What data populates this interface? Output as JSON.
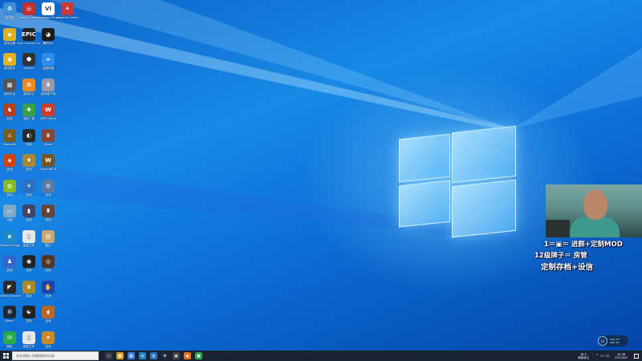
{
  "desktop_icons": [
    {
      "name": "icon-1-1",
      "label": "回收站",
      "color": "#3b8fd6",
      "glyph": "♻"
    },
    {
      "name": "icon-1-2",
      "label": "Steam Client",
      "color": "#c2302d",
      "glyph": "◎"
    },
    {
      "name": "icon-1-3",
      "label": "Wallpaper Engine",
      "color": "#ffffff",
      "glyph": "VI"
    },
    {
      "name": "icon-1-4",
      "label": "Legends Game",
      "color": "#c83a3a",
      "glyph": "✦"
    },
    {
      "name": "icon-2-1",
      "label": "游戏加速",
      "color": "#e0b020",
      "glyph": "◆"
    },
    {
      "name": "icon-2-2",
      "label": "Epic Games Launcher",
      "color": "#222222",
      "glyph": "EPIC"
    },
    {
      "name": "icon-2-3",
      "label": "腾讯QQ",
      "color": "#1b1b1b",
      "glyph": "◕"
    },
    {
      "name": "icon-3-1",
      "label": "游戏助手",
      "color": "#e0b020",
      "glyph": "◉"
    },
    {
      "name": "icon-3-2",
      "label": "Garena",
      "color": "#333333",
      "glyph": "⬢"
    },
    {
      "name": "icon-3-3",
      "label": "百度网盘",
      "color": "#2c8ff0",
      "glyph": "∞"
    },
    {
      "name": "icon-4-1",
      "label": "游戏平台",
      "color": "#555555",
      "glyph": "▦"
    },
    {
      "name": "icon-4-2",
      "label": "游戏中心",
      "color": "#f08a1c",
      "glyph": "✿"
    },
    {
      "name": "icon-4-3",
      "label": "游戏客户端",
      "color": "#9999aa",
      "glyph": "♜"
    },
    {
      "name": "icon-5-1",
      "label": "游戏",
      "color": "#b04020",
      "glyph": "♞"
    },
    {
      "name": "icon-5-2",
      "label": "游戏工具",
      "color": "#3aa044",
      "glyph": "✚"
    },
    {
      "name": "icon-5-3",
      "label": "WPS Office",
      "color": "#d23a2a",
      "glyph": "W"
    },
    {
      "name": "icon-6-1",
      "label": "Warcraft",
      "color": "#7a5a20",
      "glyph": "⚔"
    },
    {
      "name": "icon-6-2",
      "label": "游戏",
      "color": "#2a2a2a",
      "glyph": "◐"
    },
    {
      "name": "icon-6-3",
      "label": "Game",
      "color": "#884433",
      "glyph": "♛"
    },
    {
      "name": "icon-7-1",
      "label": "游戏",
      "color": "#cc4411",
      "glyph": "◈"
    },
    {
      "name": "icon-7-2",
      "label": "游戏",
      "color": "#aa8833",
      "glyph": "♦"
    },
    {
      "name": "icon-7-3",
      "label": "Warcraft III",
      "color": "#775522",
      "glyph": "W"
    },
    {
      "name": "icon-8-1",
      "label": "游戏",
      "color": "#88bb22",
      "glyph": "◍"
    },
    {
      "name": "icon-8-2",
      "label": "游戏",
      "color": "#2a6fc0",
      "glyph": "✈"
    },
    {
      "name": "icon-8-3",
      "label": "游戏",
      "color": "#5a7aa0",
      "glyph": "⚙"
    },
    {
      "name": "icon-9-1",
      "label": "电脑",
      "color": "#7fa8c8",
      "glyph": "▭"
    },
    {
      "name": "icon-9-2",
      "label": "游戏",
      "color": "#444466",
      "glyph": "▮"
    },
    {
      "name": "icon-9-3",
      "label": "游戏",
      "color": "#664433",
      "glyph": "♜"
    },
    {
      "name": "icon-10-1",
      "label": "Microsoft Edge",
      "color": "#1e88c8",
      "glyph": "e"
    },
    {
      "name": "icon-10-2",
      "label": "新建文本",
      "color": "#e8e8e8",
      "glyph": "▯"
    },
    {
      "name": "icon-10-3",
      "label": "图片",
      "color": "#c9a66b",
      "glyph": "▤"
    },
    {
      "name": "icon-11-1",
      "label": "游戏",
      "color": "#3366cc",
      "glyph": "♟"
    },
    {
      "name": "icon-11-2",
      "label": "游戏",
      "color": "#222222",
      "glyph": "◉"
    },
    {
      "name": "icon-11-3",
      "label": "游戏",
      "color": "#553322",
      "glyph": "◎"
    },
    {
      "name": "icon-12-1",
      "label": "GeForce Experience",
      "color": "#2a2a2a",
      "glyph": "◤"
    },
    {
      "name": "icon-12-2",
      "label": "游戏",
      "color": "#aa8822",
      "glyph": "♛"
    },
    {
      "name": "icon-12-3",
      "label": "游戏",
      "color": "#2244aa",
      "glyph": "✋"
    },
    {
      "name": "icon-13-1",
      "label": "Steam",
      "color": "#1b2838",
      "glyph": "⚙"
    },
    {
      "name": "icon-13-2",
      "label": "游戏",
      "color": "#222222",
      "glyph": "☯"
    },
    {
      "name": "icon-13-3",
      "label": "游戏",
      "color": "#bb6622",
      "glyph": "◖"
    },
    {
      "name": "icon-14-1",
      "label": "微信",
      "color": "#2aa84a",
      "glyph": "✉"
    },
    {
      "name": "icon-14-2",
      "label": "新建文本",
      "color": "#e8e8e8",
      "glyph": "▯"
    },
    {
      "name": "icon-14-3",
      "label": "游戏",
      "color": "#cc8822",
      "glyph": "✦"
    }
  ],
  "stream_overlay": {
    "line1": "1＝▣＝ 进群+定制MOD",
    "line2": "12级牌子＝ 房管",
    "line3": "定制存档+设信"
  },
  "taskbar": {
    "search_placeholder": "在这里输入你要搜索的内容",
    "pinned": [
      {
        "name": "task-view-icon",
        "glyph": "▭",
        "color": "#333a48"
      },
      {
        "name": "file-explorer-icon",
        "glyph": "▣",
        "color": "#d9a520"
      },
      {
        "name": "store-icon",
        "glyph": "▦",
        "color": "#3a7bd5"
      },
      {
        "name": "edge-icon",
        "glyph": "e",
        "color": "#1e88c8"
      },
      {
        "name": "app-icon-1",
        "glyph": "◍",
        "color": "#2a6fc0"
      },
      {
        "name": "steam-taskbar-icon",
        "glyph": "⚙",
        "color": "#1b2838"
      },
      {
        "name": "app-icon-2",
        "glyph": "◉",
        "color": "#444"
      },
      {
        "name": "app-icon-3",
        "glyph": "◆",
        "color": "#e07020"
      },
      {
        "name": "app-icon-4",
        "glyph": "◼",
        "color": "#2aa84a"
      }
    ],
    "tray_weather": "28°C",
    "tray_weather_sub": "局部多云",
    "tray_time": "20:38",
    "tray_date": "2021/8/5"
  },
  "perf_widget": {
    "value": "12",
    "line1": "CPU 37°",
    "line2": "GPU 43°"
  }
}
